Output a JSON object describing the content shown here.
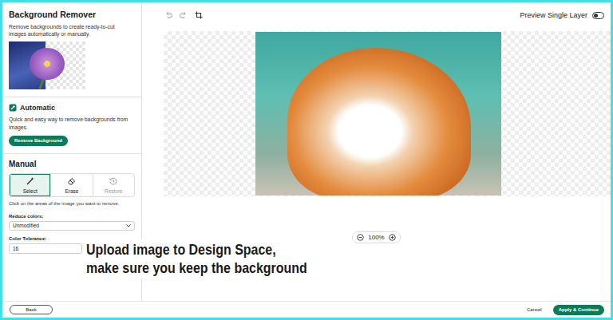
{
  "sidebar": {
    "title": "Background Remover",
    "description": "Remove backgrounds to create ready-to-cut images automatically or manually.",
    "automatic": {
      "title": "Automatic",
      "description": "Quick and easy way to remove backgrounds from images.",
      "button": "Remove Background"
    },
    "manual": {
      "title": "Manual",
      "tools": [
        {
          "label": "Select",
          "selected": true,
          "disabled": false,
          "kind": "select"
        },
        {
          "label": "Erase",
          "selected": false,
          "disabled": false,
          "kind": "erase"
        },
        {
          "label": "Restore",
          "selected": false,
          "disabled": true,
          "kind": "restore"
        }
      ],
      "hint": "Click on the areas of the image you want to remove.",
      "reduce_colors": {
        "label": "Reduce colors:",
        "value": "Unmodified"
      },
      "color_tolerance": {
        "label": "Color Tolerance:",
        "value": "16"
      }
    }
  },
  "toolbar": {
    "preview_single_layer": {
      "label": "Preview Single Layer",
      "on": false
    }
  },
  "zoom": {
    "value": "100%"
  },
  "caption": [
    "Upload image to Design Space,",
    "make sure you keep the background"
  ],
  "footer": {
    "back": "Back",
    "cancel": "Cancel",
    "apply": "Apply & Continue"
  }
}
